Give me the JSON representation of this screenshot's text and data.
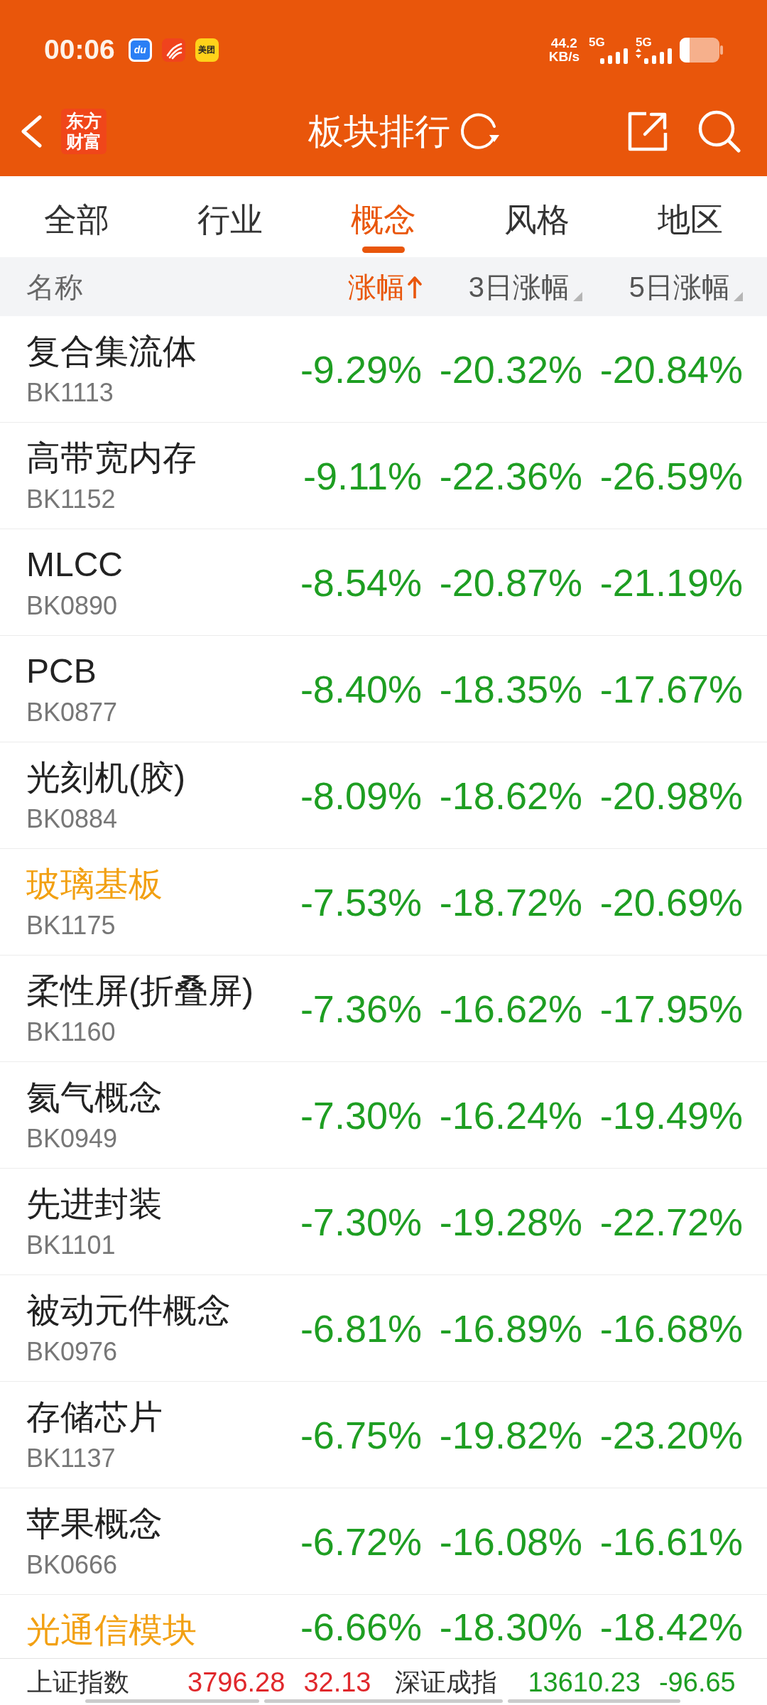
{
  "status_bar": {
    "time": "00:06",
    "notification_icons": [
      {
        "kind": "framed",
        "label": "du",
        "color": "#2b7ff5"
      },
      {
        "kind": "stripes",
        "color": "#f0431d"
      },
      {
        "kind": "plain",
        "label": "美团",
        "color": "#ffd21a"
      }
    ],
    "net_speed": "44.2",
    "net_speed_unit": "KB/s",
    "networks": [
      {
        "type": "5G",
        "data_activity": false
      },
      {
        "type": "5G",
        "data_activity": true
      }
    ]
  },
  "header": {
    "logo": "东方财富",
    "title": "板块排行"
  },
  "tabs": [
    {
      "label": "全部",
      "selected": false
    },
    {
      "label": "行业",
      "selected": false
    },
    {
      "label": "概念",
      "selected": true
    },
    {
      "label": "风格",
      "selected": false
    },
    {
      "label": "地区",
      "selected": false
    }
  ],
  "table": {
    "columns": [
      {
        "label": "名称",
        "sortable": false,
        "selected": false
      },
      {
        "label": "涨幅",
        "sortable": true,
        "selected": true
      },
      {
        "label": "3日涨幅",
        "sortable": true,
        "selected": false
      },
      {
        "label": "5日涨幅",
        "sortable": true,
        "selected": false
      }
    ],
    "rows": [
      {
        "name": "复合集流体",
        "code": "BK1113",
        "highlighted": false,
        "falling": true,
        "values": [
          "-9.29%",
          "-20.32%",
          "-20.84%"
        ]
      },
      {
        "name": "高带宽内存",
        "code": "BK1152",
        "highlighted": false,
        "falling": true,
        "values": [
          "-9.11%",
          "-22.36%",
          "-26.59%"
        ]
      },
      {
        "name": "MLCC",
        "code": "BK0890",
        "highlighted": false,
        "falling": true,
        "values": [
          "-8.54%",
          "-20.87%",
          "-21.19%"
        ]
      },
      {
        "name": "PCB",
        "code": "BK0877",
        "highlighted": false,
        "falling": true,
        "values": [
          "-8.40%",
          "-18.35%",
          "-17.67%"
        ]
      },
      {
        "name": "光刻机(胶)",
        "code": "BK0884",
        "highlighted": false,
        "falling": true,
        "values": [
          "-8.09%",
          "-18.62%",
          "-20.98%"
        ]
      },
      {
        "name": "玻璃基板",
        "code": "BK1175",
        "highlighted": true,
        "falling": true,
        "values": [
          "-7.53%",
          "-18.72%",
          "-20.69%"
        ]
      },
      {
        "name": "柔性屏(折叠屏)",
        "code": "BK1160",
        "highlighted": false,
        "falling": true,
        "values": [
          "-7.36%",
          "-16.62%",
          "-17.95%"
        ]
      },
      {
        "name": "氦气概念",
        "code": "BK0949",
        "highlighted": false,
        "falling": true,
        "values": [
          "-7.30%",
          "-16.24%",
          "-19.49%"
        ]
      },
      {
        "name": "先进封装",
        "code": "BK1101",
        "highlighted": false,
        "falling": true,
        "values": [
          "-7.30%",
          "-19.28%",
          "-22.72%"
        ]
      },
      {
        "name": "被动元件概念",
        "code": "BK0976",
        "highlighted": false,
        "falling": true,
        "values": [
          "-6.81%",
          "-16.89%",
          "-16.68%"
        ]
      },
      {
        "name": "存储芯片",
        "code": "BK1137",
        "highlighted": false,
        "falling": true,
        "values": [
          "-6.75%",
          "-19.82%",
          "-23.20%"
        ]
      },
      {
        "name": "苹果概念",
        "code": "BK0666",
        "highlighted": false,
        "falling": true,
        "values": [
          "-6.72%",
          "-16.08%",
          "-16.61%"
        ]
      },
      {
        "name": "光通信模块",
        "highlighted": true,
        "falling": true,
        "values": [
          "-6.66%",
          "-18.30%",
          "-18.42%"
        ]
      }
    ]
  },
  "index_bar": [
    {
      "name": "上证指数",
      "value": "3796.28",
      "change": "32.13",
      "falling": false
    },
    {
      "name": "深证成指",
      "value": "13610.23",
      "change": "-96.65",
      "falling": true
    }
  ]
}
